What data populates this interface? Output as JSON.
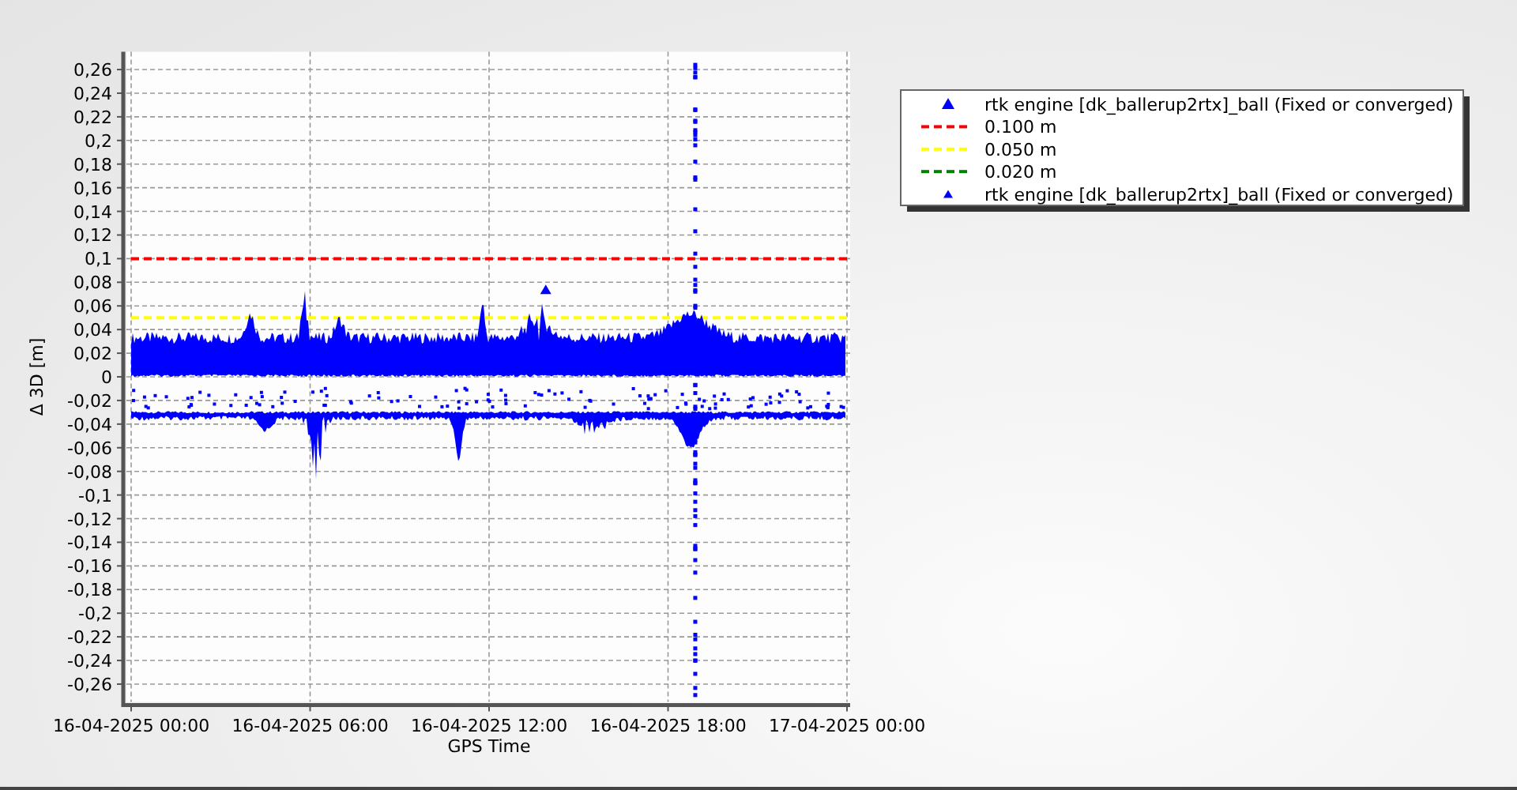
{
  "chart": {
    "chart_data": {
      "type": "line",
      "xlabel": "GPS Time",
      "ylabel": "Δ 3D [m]",
      "categories": [
        "16-04-2025 00:00",
        "16-04-2025 06:00",
        "16-04-2025 12:00",
        "16-04-2025 18:00",
        "17-04-2025 00:00"
      ],
      "series": [
        {
          "color": "#ff0000",
          "line_style": "dashed",
          "values": [
            0.1,
            0.1,
            0.1,
            0.1,
            0.1
          ]
        },
        {
          "color": "#ffff00",
          "line_style": "dashed",
          "values": [
            0.05,
            0.05,
            0.05,
            0.05,
            0.05
          ]
        }
      ],
      "ylim": [
        -0.275,
        0.275
      ],
      "grid": true,
      "yticks": [
        {
          "value": 0.26,
          "label": "0,26"
        },
        {
          "value": 0.24,
          "label": "0,24"
        },
        {
          "value": 0.22,
          "label": "0,22"
        },
        {
          "value": 0.2,
          "label": "0,2"
        },
        {
          "value": 0.18,
          "label": "0,18"
        },
        {
          "value": 0.16,
          "label": "0,16"
        },
        {
          "value": 0.14,
          "label": "0,14"
        },
        {
          "value": 0.12,
          "label": "0,12"
        },
        {
          "value": 0.1,
          "label": "0,1"
        },
        {
          "value": 0.08,
          "label": "0,08"
        },
        {
          "value": 0.06,
          "label": "0,06"
        },
        {
          "value": 0.04,
          "label": "0,04"
        },
        {
          "value": 0.02,
          "label": "0,02"
        },
        {
          "value": 0,
          "label": "0"
        },
        {
          "value": -0.02,
          "label": "-0,02"
        },
        {
          "value": -0.04,
          "label": "-0,04"
        },
        {
          "value": -0.06,
          "label": "-0,06"
        },
        {
          "value": -0.08,
          "label": "-0,08"
        },
        {
          "value": -0.1,
          "label": "-0,1"
        },
        {
          "value": -0.12,
          "label": "-0,12"
        },
        {
          "value": -0.14,
          "label": "-0,14"
        },
        {
          "value": -0.16,
          "label": "-0,16"
        },
        {
          "value": -0.18,
          "label": "-0,18"
        },
        {
          "value": -0.2,
          "label": "-0,2"
        },
        {
          "value": -0.22,
          "label": "-0,22"
        },
        {
          "value": -0.24,
          "label": "-0,24"
        },
        {
          "value": -0.26,
          "label": "-0,26"
        }
      ]
    },
    "legend": [
      {
        "kind": "marker-large",
        "label": "rtk engine [dk_ballerup2rtx]_ball (Fixed or converged)",
        "color": "#0000ff"
      },
      {
        "kind": "line",
        "label": "0.100 m",
        "color": "#ff0000"
      },
      {
        "kind": "line",
        "label": "0.050 m",
        "color": "#ffff00"
      },
      {
        "kind": "line",
        "label": "0.020 m",
        "color": "#008000"
      },
      {
        "kind": "marker-small",
        "label": "rtk engine [dk_ballerup2rtx]_ball (Fixed or converged)",
        "color": "#0000ff"
      }
    ]
  }
}
